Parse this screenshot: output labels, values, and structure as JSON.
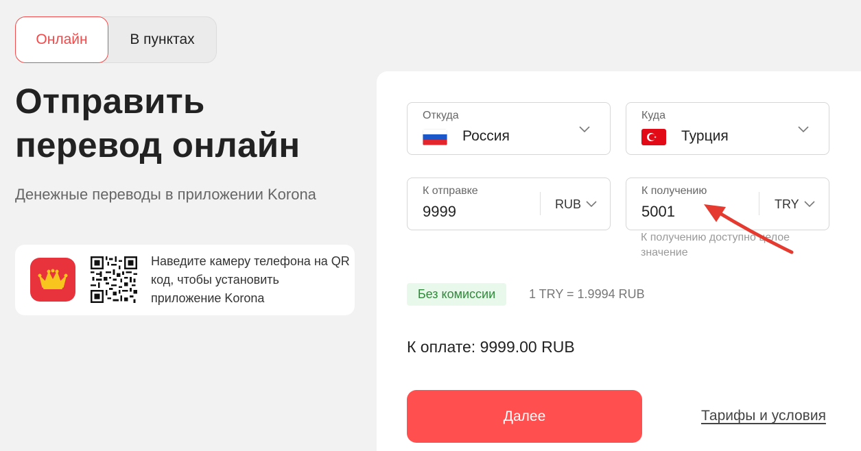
{
  "tabs": {
    "online": "Онлайн",
    "points": "В пунктах"
  },
  "hero": {
    "title_line1": "Отправить",
    "title_line2": "перевод онлайн",
    "subtitle": "Денежные переводы в приложении Korona"
  },
  "qr_card": {
    "text": "Наведите камеру телефона на QR код, чтобы установить приложение Korona"
  },
  "form": {
    "from": {
      "label": "Откуда",
      "country": "Россия",
      "flag": "russia-flag"
    },
    "to": {
      "label": "Куда",
      "country": "Турция",
      "flag": "turkey-flag"
    },
    "send": {
      "label": "К отправке",
      "value": "9999",
      "currency": "RUB"
    },
    "receive": {
      "label": "К получению",
      "value": "5001",
      "currency": "TRY"
    },
    "receive_hint": "К получению доступно целое значение",
    "commission_badge": "Без комиссии",
    "rate": "1 TRY = 1.9994 RUB",
    "total": "К оплате: 9999.00 RUB",
    "next_button": "Далее",
    "tariffs_link": "Тарифы и условия"
  },
  "colors": {
    "accent": "#ff4f4f",
    "badge_bg": "#e8f8ea",
    "badge_text": "#2f8a3a",
    "annotation_arrow": "#e53a2f"
  }
}
